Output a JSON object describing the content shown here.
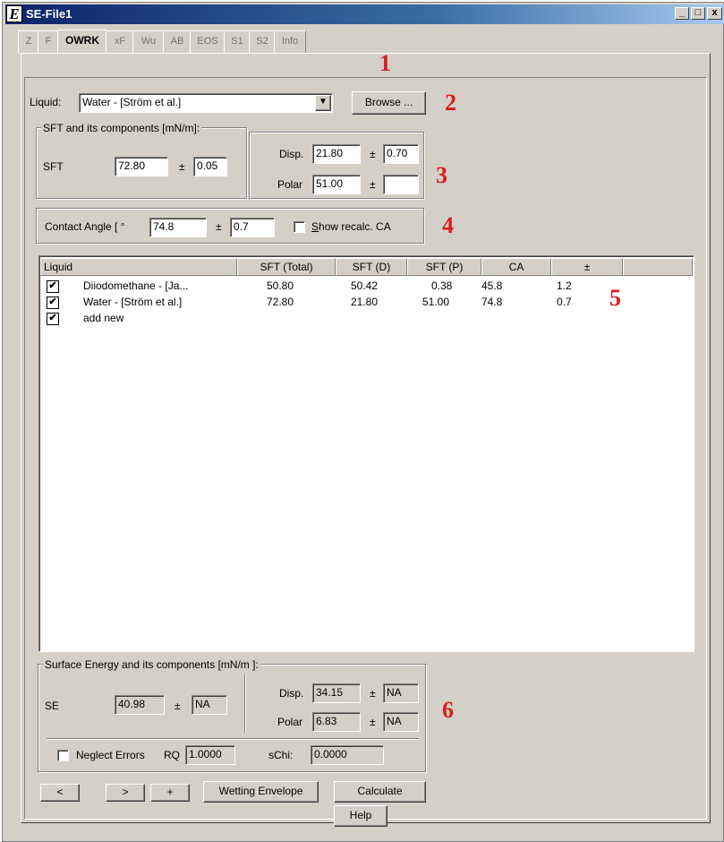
{
  "window": {
    "title": "SE-File1",
    "icon_letter": "E",
    "minimize_glyph": "_",
    "restore_glyph": "□",
    "close_glyph": "x"
  },
  "tabs": [
    {
      "label": "Z",
      "active": false
    },
    {
      "label": "F",
      "active": false
    },
    {
      "label": "OWRK",
      "active": true
    },
    {
      "label": "xF",
      "active": false
    },
    {
      "label": "Wu",
      "active": false
    },
    {
      "label": "AB",
      "active": false
    },
    {
      "label": "EOS",
      "active": false
    },
    {
      "label": "S1",
      "active": false
    },
    {
      "label": "S2",
      "active": false
    },
    {
      "label": "Info",
      "active": false
    }
  ],
  "annotations": [
    "1",
    "2",
    "3",
    "4",
    "5",
    "6"
  ],
  "liquid": {
    "label": "Liquid:",
    "value": "Water - [Ström et al.]",
    "browse_label": "Browse ..."
  },
  "sft": {
    "group_title": "SFT and its components [mN/m]:",
    "sft_label": "SFT",
    "sft_value": "72.80",
    "pm": "±",
    "sft_error": "0.05",
    "disp_label": "Disp.",
    "disp_value": "21.80",
    "disp_error": "0.70",
    "polar_label": "Polar",
    "polar_value": "51.00",
    "polar_error": ""
  },
  "contact_angle": {
    "label": "Contact Angle [ °",
    "value": "74.8",
    "pm": "±",
    "error": "0.7",
    "show_recalc_label_prefix": "S",
    "show_recalc_label_rest": "how recalc. CA",
    "show_recalc_checked": false
  },
  "table": {
    "columns": [
      "Liquid",
      "SFT (Total)",
      "SFT (D)",
      "SFT (P)",
      "CA",
      "±"
    ],
    "rows": [
      {
        "checked": true,
        "liquid": "Diiodomethane - [Ja...",
        "sft_total": "50.80",
        "sft_d": "50.42",
        "sft_p": "0.38",
        "ca": "45.8",
        "err": "1.2"
      },
      {
        "checked": true,
        "liquid": "Water - [Ström et al.]",
        "sft_total": "72.80",
        "sft_d": "21.80",
        "sft_p": "51.00",
        "ca": "74.8",
        "err": "0.7"
      },
      {
        "checked": true,
        "liquid": "add new",
        "sft_total": "",
        "sft_d": "",
        "sft_p": "",
        "ca": "",
        "err": ""
      }
    ],
    "check_glyph": "✔"
  },
  "surface_energy": {
    "group_title": "Surface Energy and its components [mN/m ]:",
    "se_label": "SE",
    "se_value": "40.98",
    "pm": "±",
    "se_error": "NA",
    "disp_label": "Disp.",
    "disp_value": "34.15",
    "disp_error": "NA",
    "polar_label": "Polar",
    "polar_value": "6.83",
    "polar_error": "NA",
    "neglect_errors_label": "Neglect Errors",
    "neglect_errors_checked": false,
    "rq_label": "RQ",
    "rq_value": "1.0000",
    "schi_label": "sChi:",
    "schi_value": "0.0000"
  },
  "buttons": {
    "prev": "<",
    "next": ">",
    "add": "+",
    "wetting_envelope": "Wetting Envelope",
    "calculate": "Calculate",
    "help": "Help"
  }
}
